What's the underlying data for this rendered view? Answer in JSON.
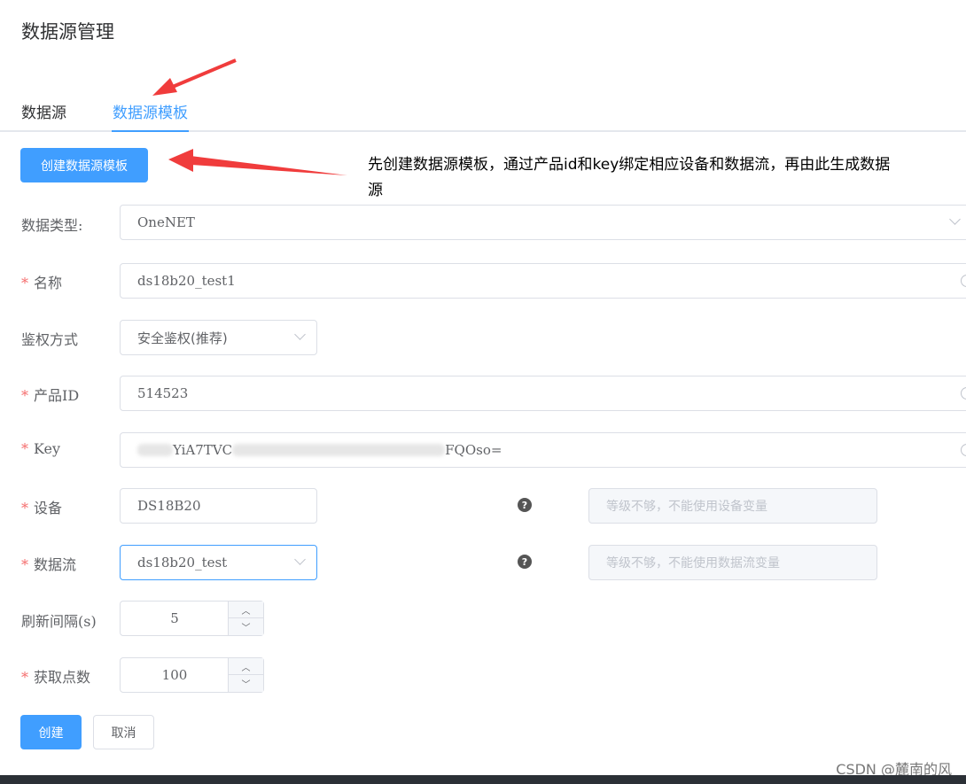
{
  "page": {
    "title": "数据源管理"
  },
  "tabs": [
    {
      "label": "数据源"
    },
    {
      "label": "数据源模板",
      "active": true
    }
  ],
  "create_template_button": "创建数据源模板",
  "annotation": "先创建数据源模板，通过产品id和key绑定相应设备和数据流，再由此生成数据源",
  "form": {
    "data_type": {
      "label": "数据类型:",
      "value": "OneNET"
    },
    "name": {
      "label": "名称",
      "required": true,
      "value": "ds18b20_test1"
    },
    "auth": {
      "label": "鉴权方式",
      "value": "安全鉴权(推荐)"
    },
    "product_id": {
      "label": "产品ID",
      "required": true,
      "value": "514523"
    },
    "key": {
      "label": "Key",
      "required": true,
      "value_visible_start": "YiA7TVC",
      "value_visible_end": "FQOso="
    },
    "device": {
      "label": "设备",
      "required": true,
      "value": "DS18B20",
      "variable_placeholder": "等级不够，不能使用设备变量"
    },
    "stream": {
      "label": "数据流",
      "required": true,
      "value": "ds18b20_test",
      "variable_placeholder": "等级不够，不能使用数据流变量"
    },
    "refresh": {
      "label": "刷新间隔(s)",
      "value": "5"
    },
    "points": {
      "label": "获取点数",
      "required": true,
      "value": "100"
    },
    "required_mark": "*",
    "help_glyph": "?"
  },
  "buttons": {
    "create": "创建",
    "cancel": "取消"
  },
  "watermark": "CSDN @麓南的风",
  "colors": {
    "primary": "#409eff",
    "required": "#f56c6c",
    "annotation_arrow": "#f03c3c"
  }
}
